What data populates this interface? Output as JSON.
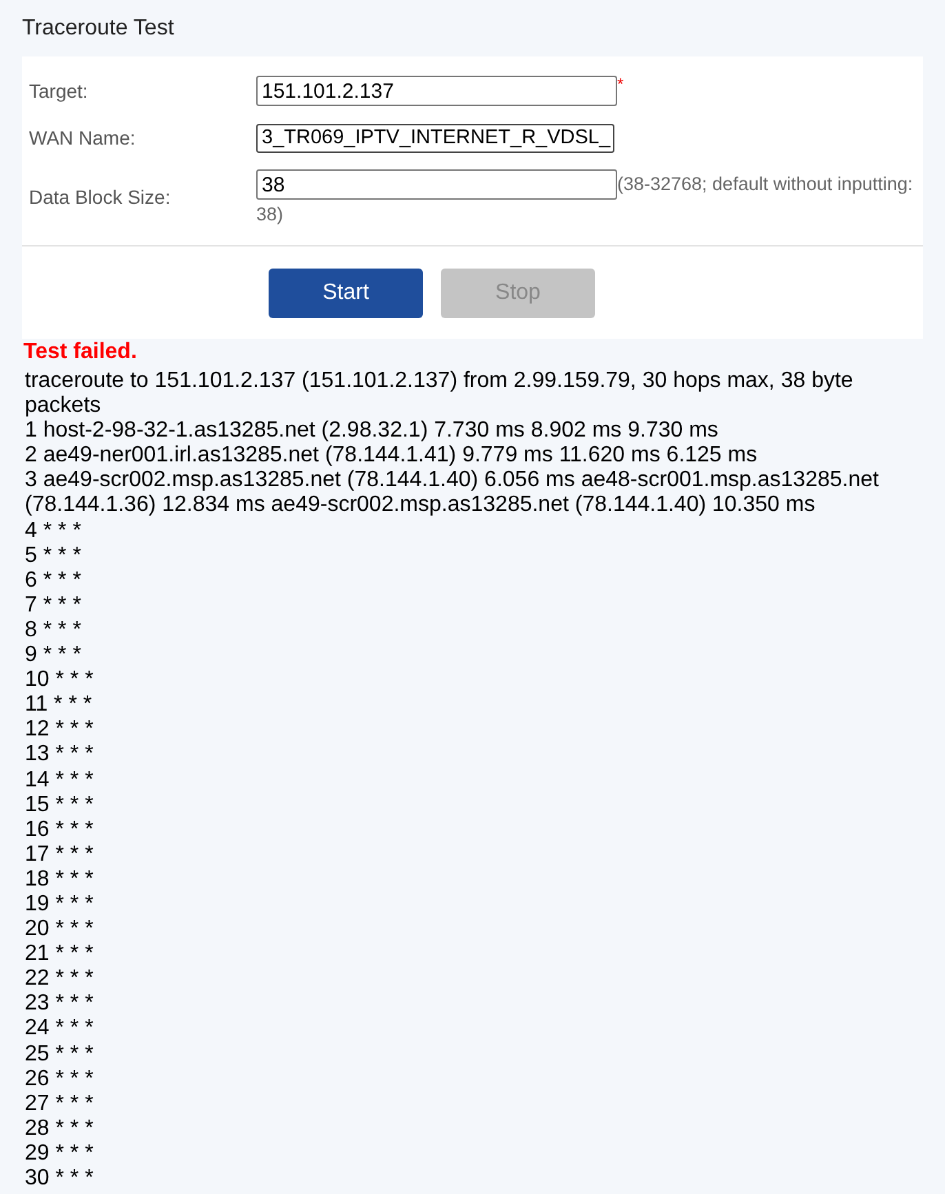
{
  "title": "Traceroute Test",
  "form": {
    "fields": [
      {
        "kind": "text",
        "label": "Target:",
        "value": "151.101.2.137",
        "mark": "*"
      },
      {
        "kind": "select",
        "label": "WAN Name:",
        "value": "3_TR069_IPTV_INTERNET_R_VDSL_"
      },
      {
        "kind": "text",
        "label": "Data Block Size:",
        "value": "38",
        "hint": [
          "(38-32768; default without inputting:",
          "38)"
        ]
      }
    ],
    "buttons": [
      {
        "label": "Start",
        "disabled": false
      },
      {
        "label": "Stop",
        "disabled": true
      }
    ]
  },
  "status": "Test failed.",
  "output": [
    "traceroute to 151.101.2.137 (151.101.2.137) from 2.99.159.79, 30 hops max, 38 byte packets",
    "1 host-2-98-32-1.as13285.net (2.98.32.1) 7.730 ms 8.902 ms 9.730 ms",
    "2 ae49-ner001.irl.as13285.net (78.144.1.41) 9.779 ms 11.620 ms 6.125 ms",
    "3 ae49-scr002.msp.as13285.net (78.144.1.40) 6.056 ms ae48-scr001.msp.as13285.net (78.144.1.36) 12.834 ms ae49-scr002.msp.as13285.net (78.144.1.40) 10.350 ms",
    "4 * * *",
    "5 * * *",
    "6 * * *",
    "7 * * *",
    "8 * * *",
    "9 * * *",
    "10 * * *",
    "11 * * *",
    "12 * * *",
    "13 * * *",
    "14 * * *",
    "15 * * *",
    "16 * * *",
    "17 * * *",
    "18 * * *",
    "19 * * *",
    "20 * * *",
    "21 * * *",
    "22 * * *",
    "23 * * *",
    "24 * * *",
    "25 * * *",
    "26 * * *",
    "27 * * *",
    "28 * * *",
    "29 * * *",
    "30 * * *"
  ]
}
